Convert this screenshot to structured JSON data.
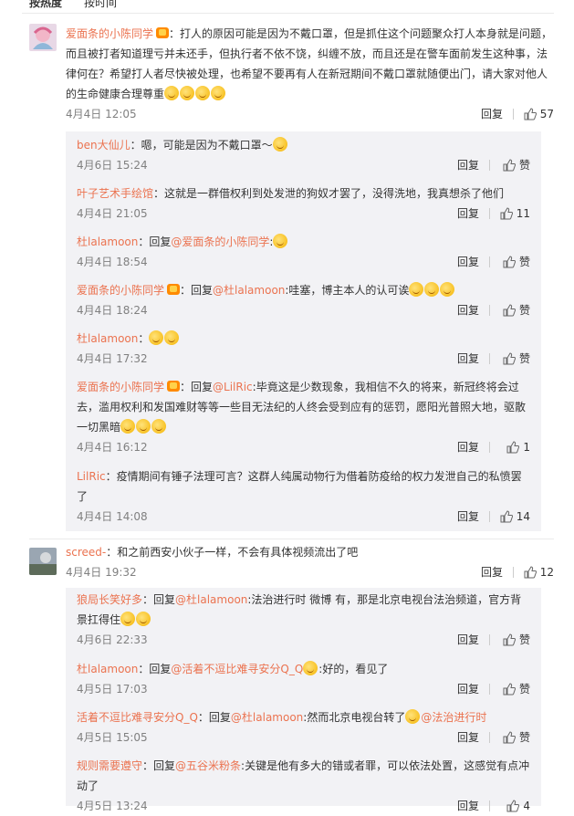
{
  "tabs": {
    "hot": "按热度",
    "time": "按时间"
  },
  "main1": {
    "name": "爱面条的小陈同学",
    "text": "：打人的原因可能是因为不戴口罩，但是抓住这个问题聚众打人本身就是问题，而且被打者知道理亏并未还手，但执行者不依不饶，纠缠不放，而且还是在警车面前发生这种事，法律何在？希望打人者尽快被处理，也希望不要再有人在新冠期间不戴口罩就随便出门，请大家对他人的生命健康合理尊重",
    "time": "4月4日 12:05",
    "reply": "回复",
    "likes": "57"
  },
  "subs1": [
    {
      "name": "ben大仙儿",
      "text": "：嗯，可能是因为不戴口罩～",
      "time": "4月6日 15:24",
      "reply": "回复",
      "likes": "赞"
    },
    {
      "name": "叶子艺术手绘馆",
      "text": "：这就是一群借权利到处发泄的狗奴才罢了，没得洗地，我真想杀了他们",
      "time": "4月4日 21:05",
      "reply": "回复",
      "likes": "11"
    },
    {
      "name": "杜lalamoon",
      "text": "：回复",
      "at": "@爱面条的小陈同学",
      "after": ":",
      "time": "4月4日 18:54",
      "reply": "回复",
      "likes": "赞"
    },
    {
      "name": "爱面条的小陈同学",
      "text": "：回复",
      "at": "@杜lalamoon",
      "after": ":哇塞，博主本人的认可诶",
      "time": "4月4日 18:24",
      "reply": "回复",
      "likes": "赞"
    },
    {
      "name": "杜lalamoon",
      "text": "：",
      "time": "4月4日 17:32",
      "reply": "回复",
      "likes": "赞"
    },
    {
      "name": "爱面条的小陈同学",
      "text": "：回复",
      "at": "@LilRic",
      "after": ":毕竟这是少数现象，我相信不久的将来，新冠终将会过去，滥用权利和发国难财等等一些目无法纪的人终会受到应有的惩罚，愿阳光普照大地，驱散一切黑暗",
      "time": "4月4日 16:12",
      "reply": "回复",
      "likes": "1"
    },
    {
      "name": "LilRic",
      "text": "：疫情期间有锤子法理可言？这群人纯属动物行为借着防疫给的权力发泄自己的私愤罢了",
      "time": "4月4日 14:08",
      "reply": "回复",
      "likes": "14"
    }
  ],
  "main2": {
    "name": "screed-",
    "text": "：和之前西安小伙子一样，不会有具体视频流出了吧",
    "time": "4月4日 19:32",
    "reply": "回复",
    "likes": "12"
  },
  "subs2": [
    {
      "name": "狼局长笑好多",
      "text": "：回复",
      "at": "@杜lalamoon",
      "after": ":法治进行时 微博 有，那是北京电视台法治频道，官方背景扛得住",
      "time": "4月6日 22:33",
      "reply": "回复",
      "likes": "赞"
    },
    {
      "name": "杜lalamoon",
      "text": "：回复",
      "at": "@活着不逗比难寻安分Q_Q",
      "after": ":好的，看见了",
      "time": "4月5日 17:03",
      "reply": "回复",
      "likes": "赞"
    },
    {
      "name": "活着不逗比难寻安分Q_Q",
      "text": "：回复",
      "at": "@杜lalamoon",
      "after": ":然而北京电视台转了",
      "at2": "@法治进行时",
      "time": "4月5日 15:05",
      "reply": "回复",
      "likes": "赞"
    },
    {
      "name": "规则需要遵守",
      "text": "：回复",
      "at": "@五谷米粉条",
      "after": ":关键是他有多大的错或者罪，可以依法处置，这感觉有点冲动了",
      "time": "4月5日 13:24",
      "reply": "回复",
      "likes": "4"
    }
  ]
}
